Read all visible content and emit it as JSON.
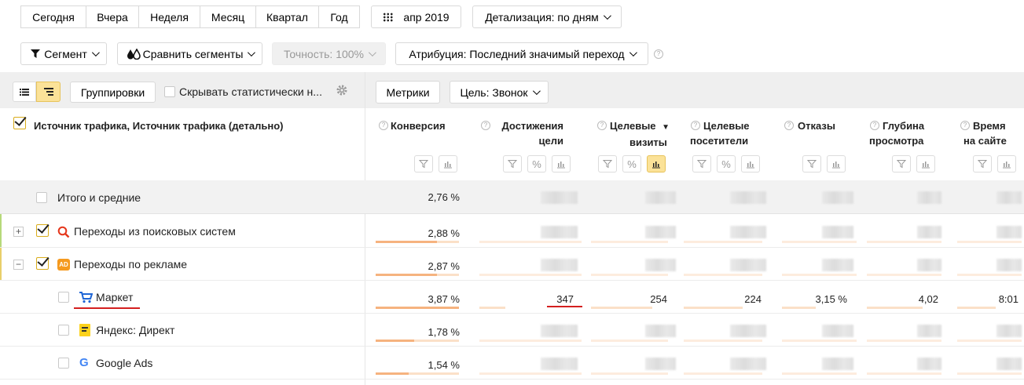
{
  "period_buttons": [
    "Сегодня",
    "Вчера",
    "Неделя",
    "Месяц",
    "Квартал",
    "Год"
  ],
  "date_label": "апр 2019",
  "detail_label": "Детализация: по дням",
  "segment_label": "Сегмент",
  "compare_label": "Сравнить сегменты",
  "accuracy_label": "Точность: 100%",
  "attribution_label": "Атрибуция: Последний значимый переход",
  "groupings_label": "Группировки",
  "hide_label": "Скрывать статистически н...",
  "metrics_label": "Метрики",
  "goal_label": "Цель: Звонок",
  "dimension_header": "Источник трафика, Источник трафика (детально)",
  "columns": [
    {
      "line1": "Конверсия",
      "line2": ""
    },
    {
      "line1": "Достижения",
      "line2": "цели"
    },
    {
      "line1": "Целевые",
      "line2": "визиты",
      "sorted": "▼"
    },
    {
      "line1": "Целевые",
      "line2": "посетители"
    },
    {
      "line1": "Отказы",
      "line2": ""
    },
    {
      "line1": "Глубина",
      "line2": "просмотра"
    },
    {
      "line1": "Время",
      "line2": "на сайте"
    }
  ],
  "rows": [
    {
      "label": "Итого и средние",
      "conv": "2,76 %"
    },
    {
      "label": "Переходы из поисковых систем",
      "conv": "2,88 %",
      "bar": 0.74
    },
    {
      "label": "Переходы по рекламе",
      "conv": "2,87 %",
      "bar": 0.74
    },
    {
      "label": "Маркет",
      "conv": "3,87 %",
      "bar": 1.0,
      "goals": "347",
      "visits": "254",
      "visitors": "224",
      "bounce": "3,15 %",
      "depth": "4,02",
      "time": "8:01"
    },
    {
      "label": "Яндекс: Директ",
      "conv": "1,78 %",
      "bar": 0.46
    },
    {
      "label": "Google Ads",
      "conv": "1,54 %",
      "bar": 0.4
    }
  ],
  "icons": {
    "segment": "funnel-icon",
    "compare": "drops-icon",
    "search_source": "magnifier-icon",
    "ad_source": "ad-badge-icon",
    "market": "cart-icon",
    "direct": "yandex-direct-icon",
    "google": "google-g-icon"
  },
  "colors": {
    "accent": "#fbe298",
    "bar": "#f6b37f",
    "annotation": "#d41f1f"
  }
}
